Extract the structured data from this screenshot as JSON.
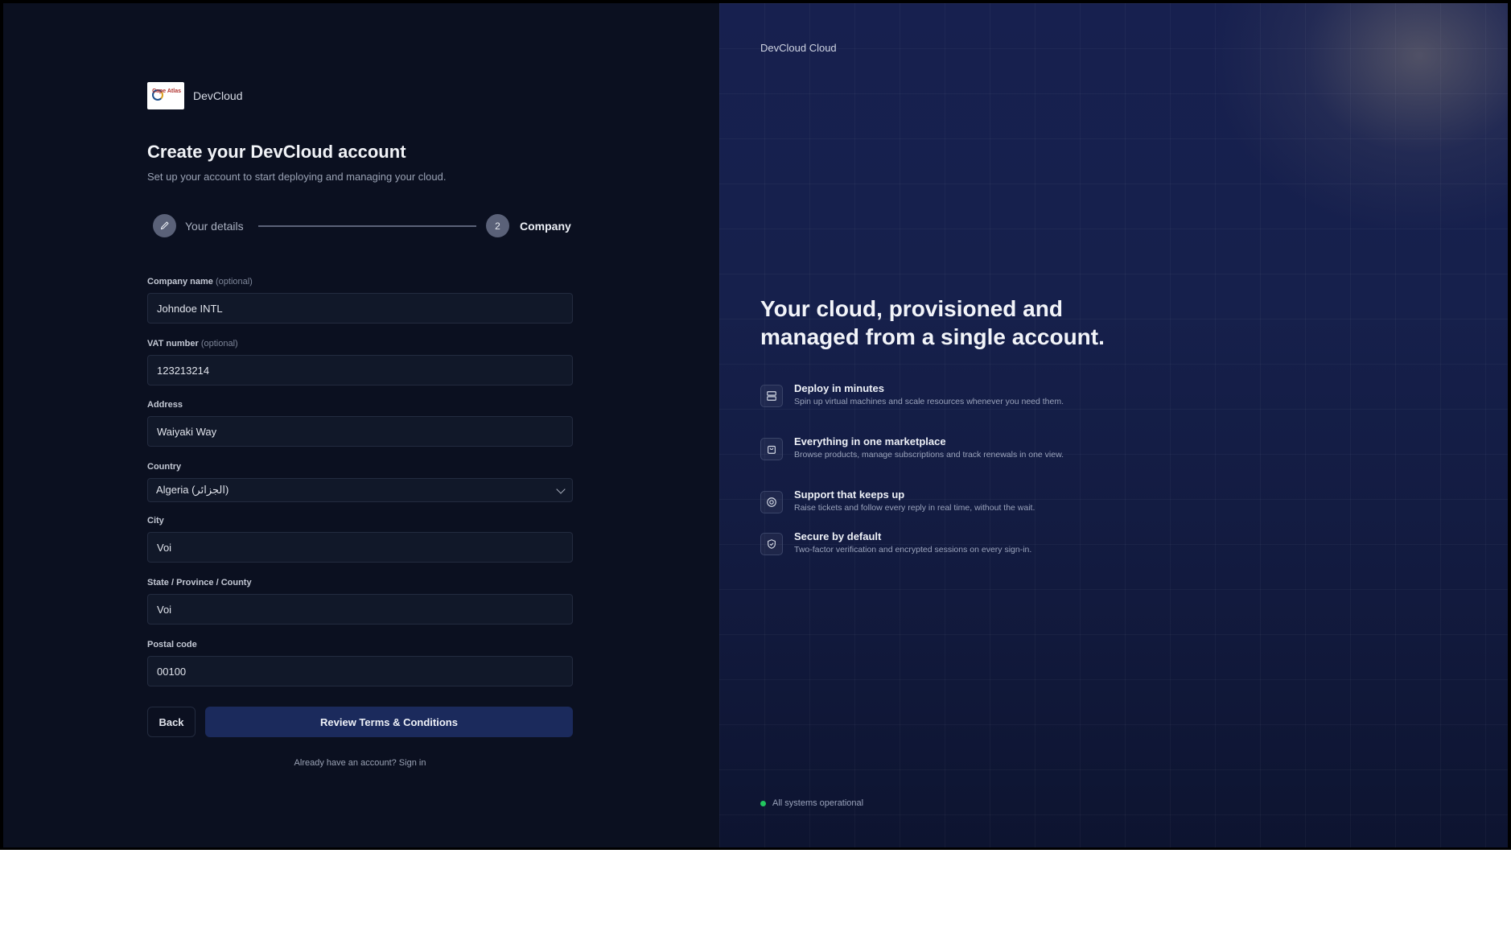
{
  "brand": {
    "name": "DevCloud",
    "logo_text": "Cape Atlas"
  },
  "form_header": {
    "title": "Create your DevCloud account",
    "subtitle": "Set up your account to start deploying and managing your cloud."
  },
  "stepper": {
    "steps": [
      {
        "label": "Your details",
        "icon": "pencil-icon",
        "state": "completed"
      },
      {
        "label": "Company",
        "number": "2",
        "state": "active"
      }
    ]
  },
  "fields": {
    "company_name": {
      "label": "Company name",
      "optional": "(optional)",
      "value": "Johndoe INTL"
    },
    "vat_number": {
      "label": "VAT number",
      "optional": "(optional)",
      "value": "123213214"
    },
    "address": {
      "label": "Address",
      "value": "Waiyaki Way"
    },
    "country": {
      "label": "Country",
      "value": "Algeria (الجزائر)"
    },
    "city": {
      "label": "City",
      "value": "Voi"
    },
    "state": {
      "label": "State / Province / County",
      "value": "Voi"
    },
    "postal_code": {
      "label": "Postal code",
      "value": "00100"
    }
  },
  "actions": {
    "back_label": "Back",
    "primary_label": "Review Terms & Conditions",
    "signin_text": "Already have an account? Sign in"
  },
  "right_panel": {
    "brand": "DevCloud Cloud",
    "headline": "Your cloud, provisioned and managed from a single account.",
    "features": [
      {
        "icon": "server-icon",
        "title": "Deploy in minutes",
        "description": "Spin up virtual machines and scale resources whenever you need them."
      },
      {
        "icon": "shopping-bag-icon",
        "title": "Everything in one marketplace",
        "description": "Browse products, manage subscriptions and track renewals in one view."
      },
      {
        "icon": "lifebuoy-icon",
        "title": "Support that keeps up",
        "description": "Raise tickets and follow every reply in real time, without the wait."
      },
      {
        "icon": "shield-check-icon",
        "title": "Secure by default",
        "description": "Two-factor verification and encrypted sessions on every sign-in."
      }
    ],
    "status_text": "All systems operational"
  },
  "colors": {
    "left_bg": "#0b1020",
    "right_bg": "#17204f",
    "primary_button": "#1b2a5c",
    "status_ok": "#22c55e"
  }
}
